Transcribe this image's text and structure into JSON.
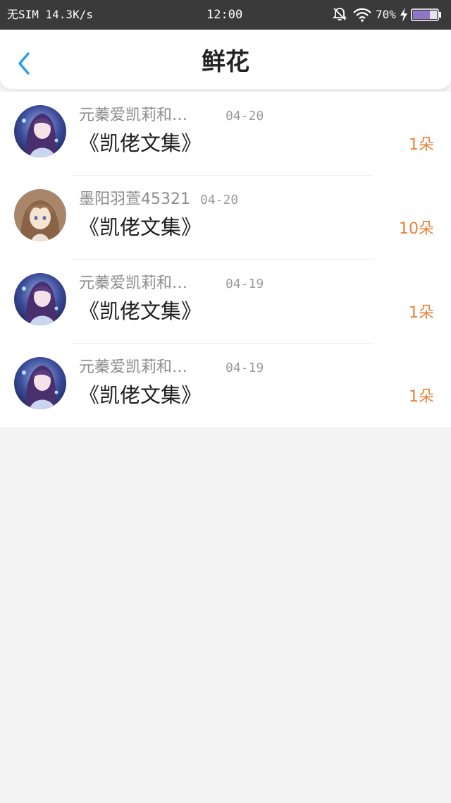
{
  "status_bar": {
    "carrier_speed": "无SIM 14.3K/s",
    "time": "12:00",
    "battery_percent": "70%",
    "battery_level": 0.7
  },
  "header": {
    "title": "鲜花"
  },
  "records": [
    {
      "user": "元蓁爱凯莉和…",
      "date": "04-20",
      "book": "《凯佬文集》",
      "count": "1朵",
      "avatar": "purple"
    },
    {
      "user": "墨阳羽萱45321",
      "date": "04-20",
      "book": "《凯佬文集》",
      "count": "10朵",
      "avatar": "brown"
    },
    {
      "user": "元蓁爱凯莉和…",
      "date": "04-19",
      "book": "《凯佬文集》",
      "count": "1朵",
      "avatar": "purple"
    },
    {
      "user": "元蓁爱凯莉和…",
      "date": "04-19",
      "book": "《凯佬文集》",
      "count": "1朵",
      "avatar": "purple"
    }
  ],
  "colors": {
    "accent_blue": "#2b9af3",
    "count_orange": "#e8823a",
    "status_bar_bg": "#3a3a3a",
    "page_bg": "#f5f4f5"
  },
  "icons": {
    "back": "chevron-left-icon",
    "bell": "bell-off-icon",
    "wifi": "wifi-icon",
    "charging": "lightning-bolt-icon",
    "battery": "battery-icon"
  }
}
